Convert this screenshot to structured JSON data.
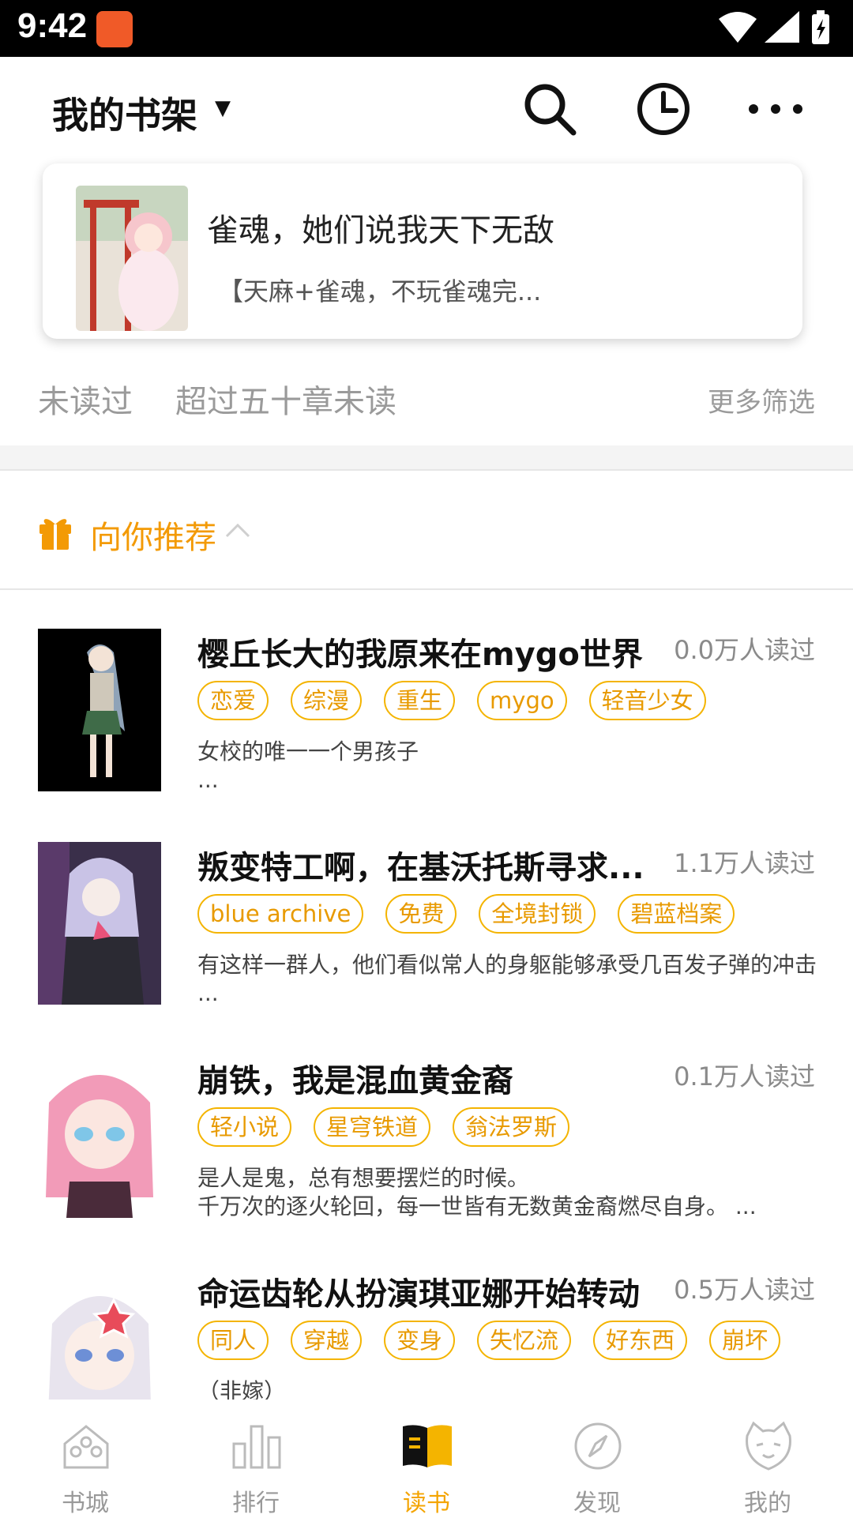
{
  "status_bar": {
    "time": "9:42"
  },
  "header": {
    "title": "我的书架"
  },
  "continue_card": {
    "book_title": "雀魂，她们说我天下无敌",
    "book_desc": "【天麻+雀魂，不玩雀魂完..."
  },
  "filters": {
    "unread": "未读过",
    "over50": "超过五十章未读",
    "more": "更多筛选"
  },
  "recommend": {
    "label": "向你推荐"
  },
  "books": [
    {
      "title": "樱丘长大的我原来在mygo世界",
      "reads": "0.0万人读过",
      "tags": [
        "恋爱",
        "综漫",
        "重生",
        "mygo",
        "轻音少女"
      ],
      "desc": "女校的唯一一个男孩子\n ..."
    },
    {
      "title": "叛变特工啊，在基沃托斯寻求...",
      "reads": "1.1万人读过",
      "tags": [
        "blue archive",
        "免费",
        "全境封锁",
        "碧蓝档案"
      ],
      "desc": "有这样一群人，他们看似常人的身躯能够承受几百发子弹的冲击 ..."
    },
    {
      "title": "崩铁，我是混血黄金裔",
      "reads": "0.1万人读过",
      "tags": [
        "轻小说",
        "星穹铁道",
        "翁法罗斯"
      ],
      "desc": "是人是鬼，总有想要摆烂的时候。\n千万次的逐火轮回，每一世皆有无数黄金裔燃尽自身。 ..."
    },
    {
      "title": "命运齿轮从扮演琪亚娜开始转动",
      "reads": "0.5万人读过",
      "tags": [
        "同人",
        "穿越",
        "变身",
        "失忆流",
        "好东西",
        "崩坏"
      ],
      "desc": "（非嫁）"
    }
  ],
  "bottom_nav": [
    {
      "label": "书城",
      "icon": "bookstore-icon"
    },
    {
      "label": "排行",
      "icon": "ranking-icon"
    },
    {
      "label": "读书",
      "icon": "reading-icon",
      "active": true
    },
    {
      "label": "发现",
      "icon": "compass-icon"
    },
    {
      "label": "我的",
      "icon": "cat-face-icon"
    }
  ],
  "colors": {
    "accent": "#f4a400",
    "tag_border": "#f4b400",
    "muted": "#9a9a9a"
  }
}
